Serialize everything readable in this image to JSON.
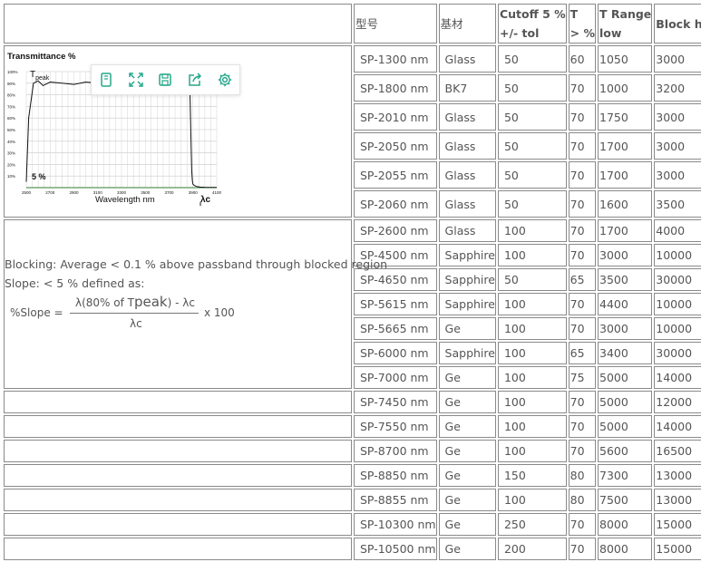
{
  "toolbar": {
    "icons": [
      "bookmark-icon",
      "expand-icon",
      "save-icon",
      "share-icon",
      "gear-icon"
    ],
    "color": "#27a68a"
  },
  "headers": {
    "model": "型号",
    "material": "基材",
    "cutoff_line1": "Cutoff 5 %",
    "cutoff_line2": "+/- tol",
    "t_line1": "T",
    "t_line2": "> %",
    "trange_line1": "T Range",
    "trange_line2": "low",
    "block": "Block high"
  },
  "chart": {
    "title": "Transmittance %",
    "y_ticks": [
      "100%",
      "90%",
      "80%",
      "70%",
      "60%",
      "50%",
      "40%",
      "30%",
      "20%",
      "10%"
    ],
    "x_ticks": [
      "2500",
      "2700",
      "2900",
      "3100",
      "3300",
      "3500",
      "3700",
      "3900",
      "4100"
    ],
    "tpeak_label": "T",
    "tpeak_sub": "peak",
    "five_label": "5 %",
    "xlabel": "Wavelength nm",
    "lambda_label": "λc"
  },
  "chart_data": {
    "type": "line",
    "title": "Transmittance %",
    "xlabel": "Wavelength nm",
    "ylabel": "",
    "xlim": [
      2500,
      4100
    ],
    "ylim": [
      0,
      100
    ],
    "x": [
      2500,
      2520,
      2560,
      2600,
      2640,
      2700,
      2800,
      2900,
      3000,
      3100,
      3200,
      3300,
      3400,
      3500,
      3600,
      3700,
      3800,
      3850,
      3870,
      3875,
      3880,
      3885,
      3890,
      3895,
      3900,
      3910,
      3930,
      3960,
      4000,
      4100
    ],
    "y": [
      5,
      60,
      90,
      92,
      88,
      91,
      90,
      89,
      91,
      90,
      90,
      91,
      89,
      90,
      91,
      90,
      91,
      92,
      90,
      82,
      60,
      35,
      15,
      6,
      3,
      2,
      1,
      0.5,
      0.3,
      0.2
    ]
  },
  "blocking_text": "Blocking: Average < 0.1 % above passband through blocked region",
  "slope_text": "Slope: < 5 % defined as:",
  "formula": {
    "lhs": "%Slope =",
    "num_a": "λ(80% of T",
    "num_peak": "peak",
    "num_b": ") - λc",
    "den": "λc",
    "times": "x 100"
  },
  "rows": [
    {
      "model": "SP-1300 nm",
      "material": "Glass",
      "cutoff": "50",
      "t": "60",
      "trange": "1050",
      "block": "3000"
    },
    {
      "model": "SP-1800 nm",
      "material": "BK7",
      "cutoff": "50",
      "t": "70",
      "trange": "1000",
      "block": "3200"
    },
    {
      "model": "SP-2010 nm",
      "material": "Glass",
      "cutoff": "50",
      "t": "70",
      "trange": "1750",
      "block": "3000"
    },
    {
      "model": "SP-2050 nm",
      "material": "Glass",
      "cutoff": "50",
      "t": "70",
      "trange": "1700",
      "block": "3000"
    },
    {
      "model": "SP-2055 nm",
      "material": "Glass",
      "cutoff": "50",
      "t": "70",
      "trange": "1700",
      "block": "3000"
    },
    {
      "model": "SP-2060 nm",
      "material": "Glass",
      "cutoff": "50",
      "t": "70",
      "trange": "1600",
      "block": "3500"
    },
    {
      "model": "SP-2600 nm",
      "material": "Glass",
      "cutoff": "100",
      "t": "70",
      "trange": "1700",
      "block": "4000"
    },
    {
      "model": "SP-4500 nm",
      "material": "Sapphire",
      "cutoff": "100",
      "t": "70",
      "trange": "3000",
      "block": "10000"
    },
    {
      "model": "SP-4650 nm",
      "material": "Sapphire",
      "cutoff": "50",
      "t": "65",
      "trange": "3500",
      "block": "30000"
    },
    {
      "model": "SP-5615 nm",
      "material": "Sapphire",
      "cutoff": "100",
      "t": "70",
      "trange": "4400",
      "block": "10000"
    },
    {
      "model": "SP-5665 nm",
      "material": "Ge",
      "cutoff": "100",
      "t": "70",
      "trange": "3000",
      "block": "10000"
    },
    {
      "model": "SP-6000 nm",
      "material": "Sapphire",
      "cutoff": "100",
      "t": "65",
      "trange": "3400",
      "block": "30000"
    },
    {
      "model": "SP-7000 nm",
      "material": "Ge",
      "cutoff": "100",
      "t": "75",
      "trange": "5000",
      "block": "14000"
    },
    {
      "model": "SP-7450 nm",
      "material": "Ge",
      "cutoff": "100",
      "t": "70",
      "trange": "5000",
      "block": "12000"
    },
    {
      "model": "SP-7550 nm",
      "material": "Ge",
      "cutoff": "100",
      "t": "70",
      "trange": "5000",
      "block": "14000"
    },
    {
      "model": "SP-8700 nm",
      "material": "Ge",
      "cutoff": "100",
      "t": "70",
      "trange": "5600",
      "block": "16500"
    },
    {
      "model": "SP-8850 nm",
      "material": "Ge",
      "cutoff": "150",
      "t": "80",
      "trange": "7300",
      "block": "13000"
    },
    {
      "model": "SP-8855 nm",
      "material": "Ge",
      "cutoff": "100",
      "t": "80",
      "trange": "7500",
      "block": "13000"
    },
    {
      "model": "SP-10300 nm",
      "material": "Ge",
      "cutoff": "250",
      "t": "70",
      "trange": "8000",
      "block": "15000"
    },
    {
      "model": "SP-10500 nm",
      "material": "Ge",
      "cutoff": "200",
      "t": "70",
      "trange": "8000",
      "block": "15000"
    }
  ]
}
